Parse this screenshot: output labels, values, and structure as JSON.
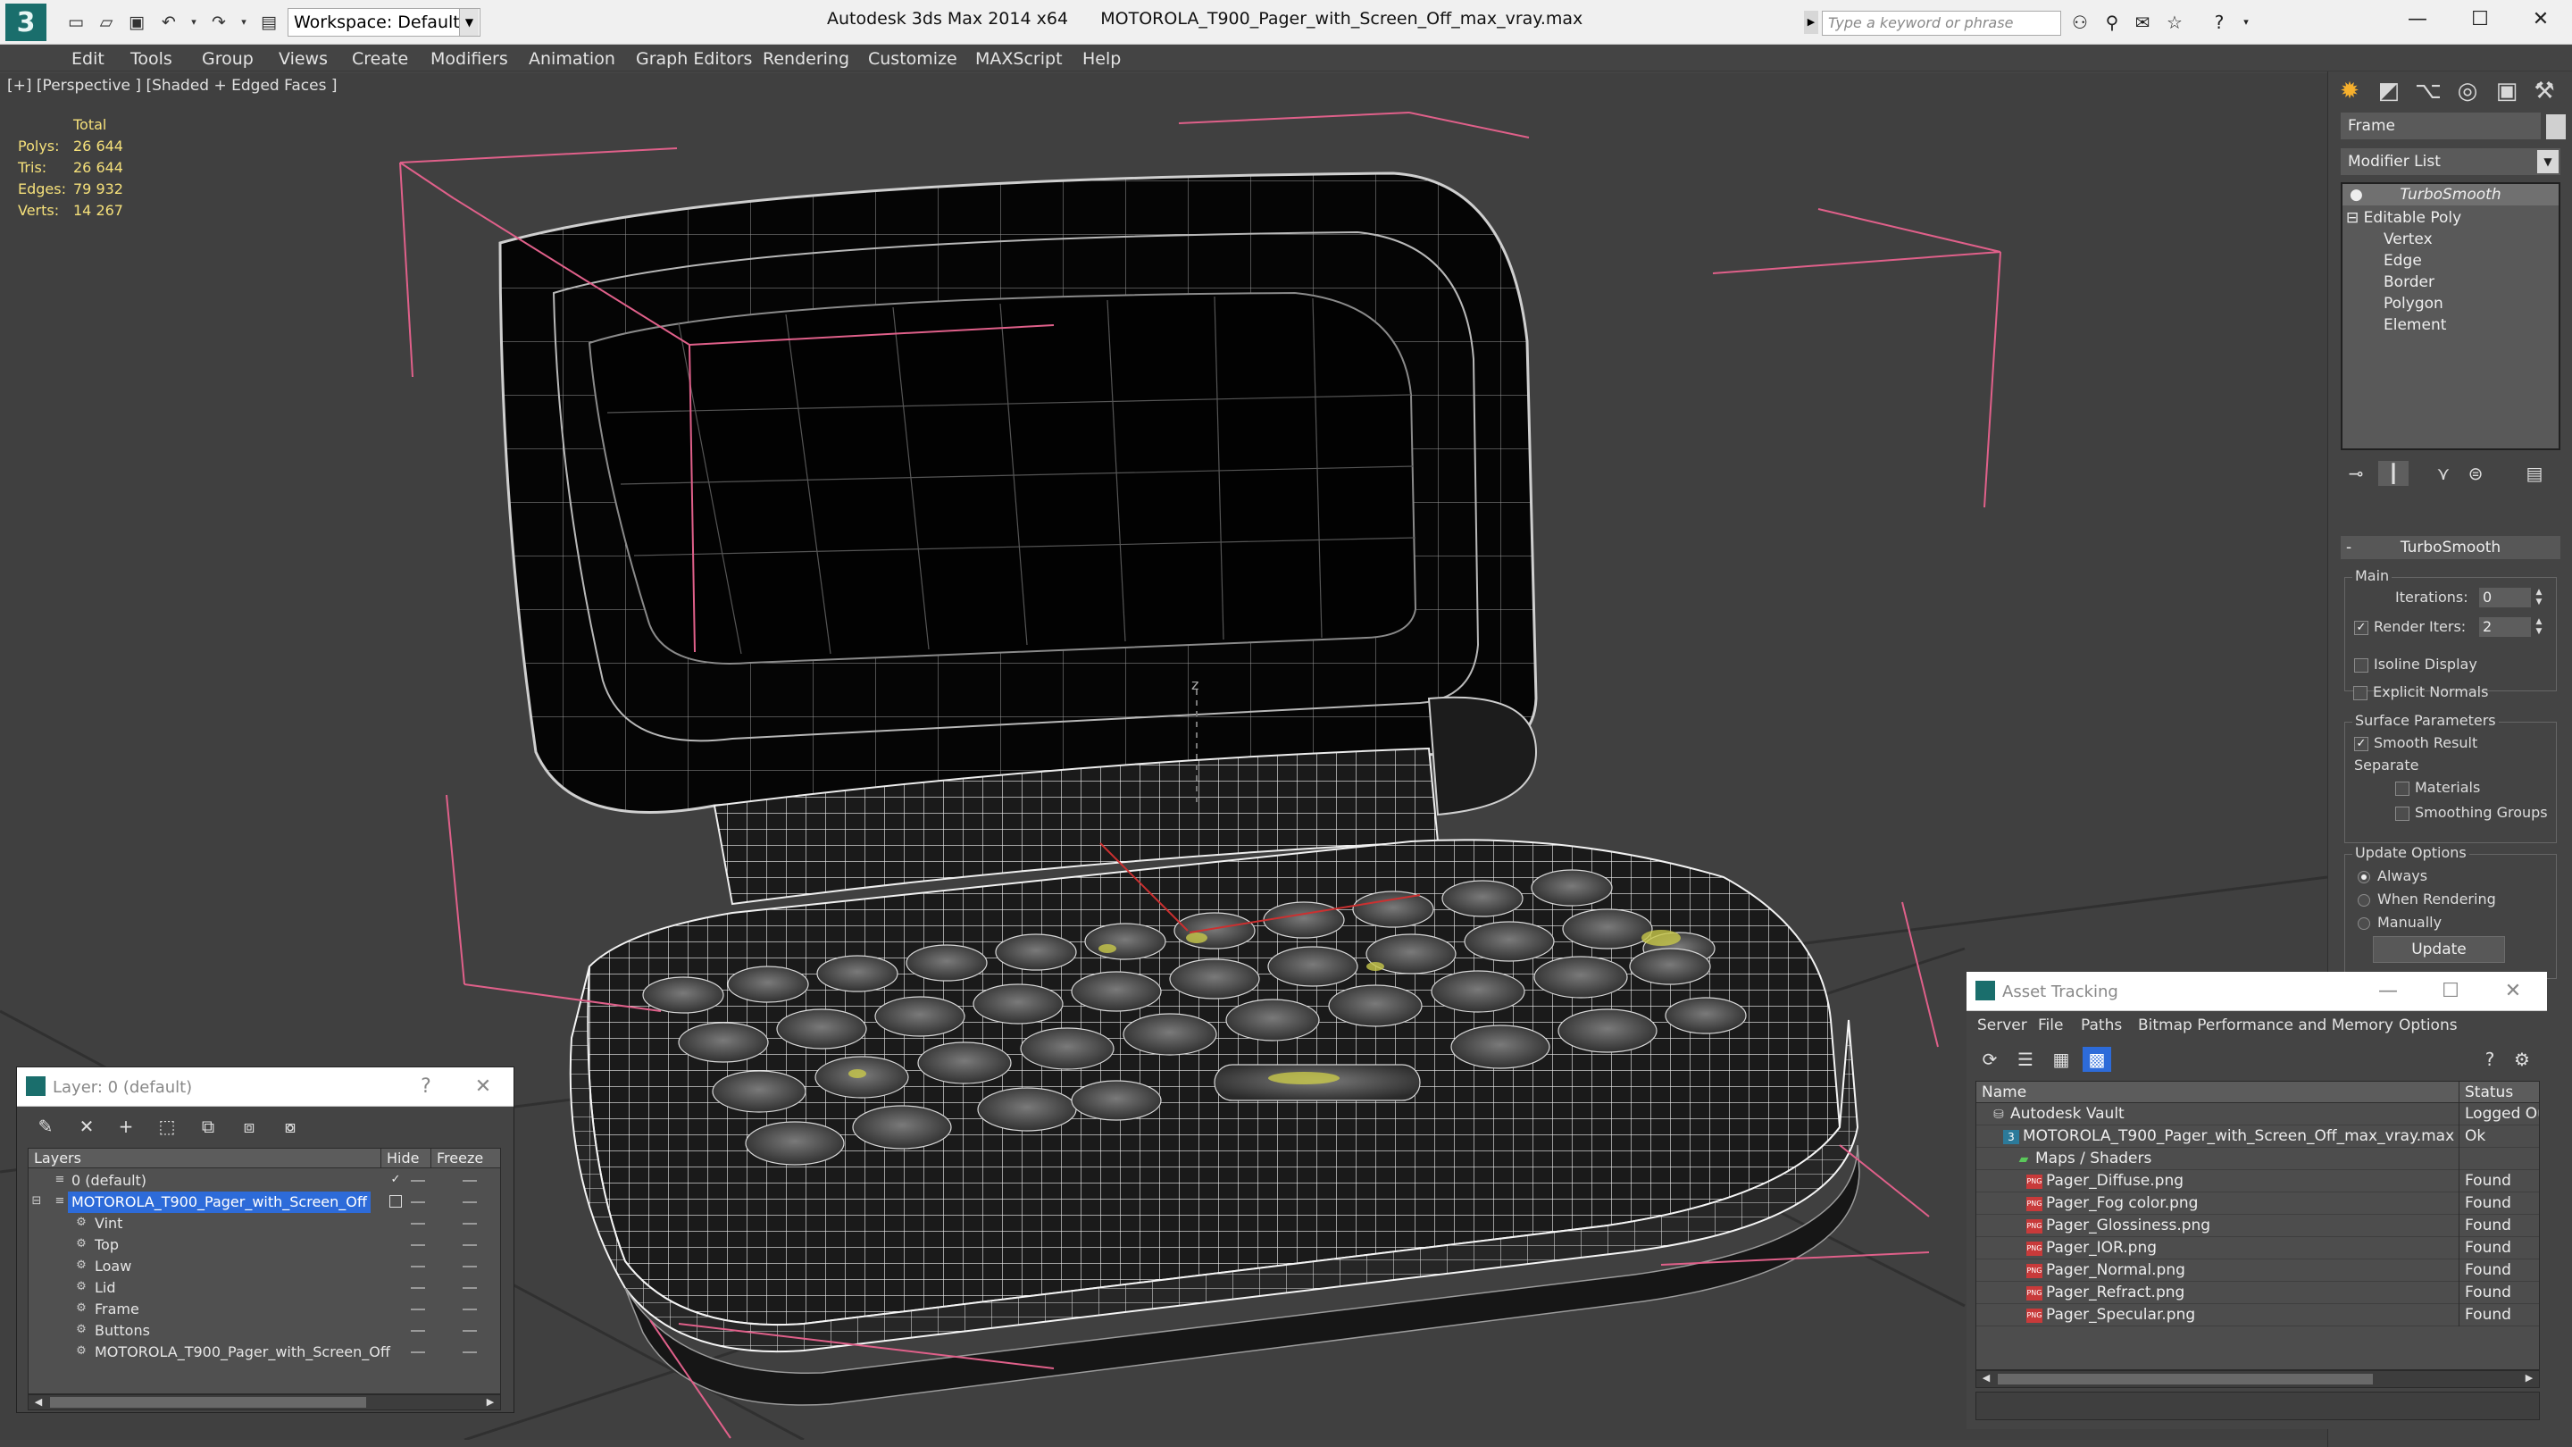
{
  "app": {
    "title": "Autodesk 3ds Max 2014 x64      MOTOROLA_T900_Pager_with_Screen_Off_max_vray.max",
    "logo_glyph": "3",
    "workspace": "Workspace: Default",
    "search_placeholder": "Type a keyword or phrase"
  },
  "menu": [
    "Edit",
    "Tools",
    "Group",
    "Views",
    "Create",
    "Modifiers",
    "Animation",
    "Graph Editors",
    "Rendering",
    "Customize",
    "MAXScript",
    "Help"
  ],
  "viewport": {
    "label": "[+] [Perspective ] [Shaded + Edged Faces ]",
    "stats": {
      "total": "Total",
      "rows": [
        {
          "label": "Polys:",
          "value": "26 644"
        },
        {
          "label": "Tris:",
          "value": "26 644"
        },
        {
          "label": "Edges:",
          "value": "79 932"
        },
        {
          "label": "Verts:",
          "value": "14 267"
        }
      ]
    },
    "axis_label": "z"
  },
  "command_panel": {
    "object_name": "Frame",
    "modifier_list": "Modifier List",
    "stack": {
      "top": "TurboSmooth",
      "base": "Editable Poly",
      "sub": [
        "Vertex",
        "Edge",
        "Border",
        "Polygon",
        "Element"
      ]
    },
    "rollout": {
      "title": "TurboSmooth",
      "collapse": "-",
      "main_group": "Main",
      "iterations_label": "Iterations:",
      "iterations_value": "0",
      "render_iters_label": "Render Iters:",
      "render_iters_value": "2",
      "render_iters_checked": "✓",
      "isoline": "Isoline Display",
      "explicit_normals": "Explicit Normals",
      "surface_group": "Surface Parameters",
      "smooth_result": "Smooth Result",
      "smooth_checked": "✓",
      "separate": "Separate",
      "materials": "Materials",
      "smoothing_groups": "Smoothing Groups",
      "update_group": "Update Options",
      "always": "Always",
      "when_rendering": "When Rendering",
      "manually": "Manually",
      "update_button": "Update"
    }
  },
  "layer_panel": {
    "title": "Layer: 0 (default)",
    "help": "?",
    "close": "✕",
    "columns": {
      "layers": "Layers",
      "hide": "Hide",
      "freeze": "Freeze"
    },
    "rows": [
      {
        "name": "0 (default)",
        "checked": "✓"
      },
      {
        "name": "MOTOROLA_T900_Pager_with_Screen_Off"
      },
      {
        "name": "Vint"
      },
      {
        "name": "Top"
      },
      {
        "name": "Loaw"
      },
      {
        "name": "Lid"
      },
      {
        "name": "Frame"
      },
      {
        "name": "Buttons"
      },
      {
        "name": "MOTOROLA_T900_Pager_with_Screen_Off"
      }
    ]
  },
  "asset_panel": {
    "title": "Asset Tracking",
    "menu": [
      "Server",
      "File",
      "Paths",
      "Bitmap Performance and Memory",
      "Options"
    ],
    "columns": {
      "name": "Name",
      "status": "Status"
    },
    "rows": [
      {
        "name": "Autodesk Vault",
        "status": "Logged Ou"
      },
      {
        "name": "MOTOROLA_T900_Pager_with_Screen_Off_max_vray.max",
        "status": "Ok"
      },
      {
        "name": "Maps / Shaders",
        "status": ""
      },
      {
        "name": "Pager_Diffuse.png",
        "status": "Found"
      },
      {
        "name": "Pager_Fog color.png",
        "status": "Found"
      },
      {
        "name": "Pager_Glossiness.png",
        "status": "Found"
      },
      {
        "name": "Pager_IOR.png",
        "status": "Found"
      },
      {
        "name": "Pager_Normal.png",
        "status": "Found"
      },
      {
        "name": "Pager_Refract.png",
        "status": "Found"
      },
      {
        "name": "Pager_Specular.png",
        "status": "Found"
      }
    ],
    "file_icon_text": "PNG"
  },
  "colors": {
    "accent": "#2d6bd9",
    "stats_text": "#f5e07a",
    "gizmo": "#e0608a",
    "wire": "#e8e8e8",
    "brand": "#1a6e6c"
  }
}
